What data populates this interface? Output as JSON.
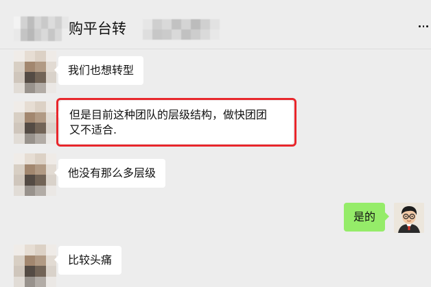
{
  "header": {
    "title": "购平台转",
    "more_icon": "more-dots-icon"
  },
  "messages": [
    {
      "side": "left",
      "text": "我们也想转型"
    },
    {
      "side": "left",
      "text": "但是目前这种团队的层级结构，做快团团又不适合.",
      "line1": "但是目前这种团队的层级结构，做快团团",
      "line2": "又不适合.",
      "highlighted": true
    },
    {
      "side": "left",
      "text": "他没有那么多层级"
    },
    {
      "side": "right",
      "text": "是的"
    },
    {
      "side": "left",
      "text": "比较头痛"
    }
  ],
  "colors": {
    "background": "#ededed",
    "bubble_in": "#ffffff",
    "bubble_out": "#95ec69",
    "highlight": "#e8262b"
  }
}
